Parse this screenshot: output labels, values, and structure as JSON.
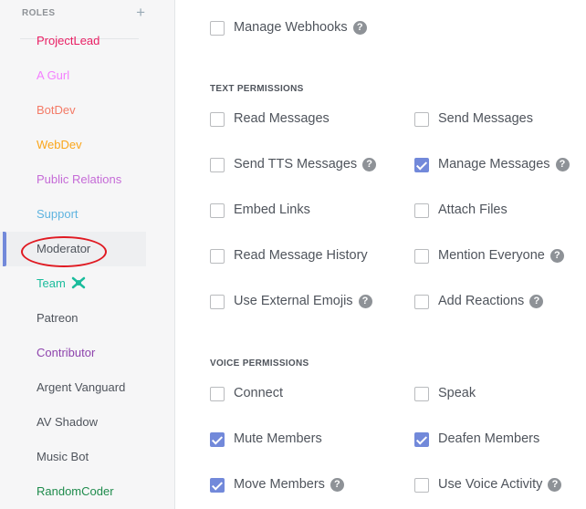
{
  "sidebar": {
    "title": "ROLES",
    "add_icon": "+",
    "roles": [
      {
        "name": "ProjectLead",
        "color": "#e91e63"
      },
      {
        "name": "A Gurl",
        "color": "#f47fff"
      },
      {
        "name": "BotDev",
        "color": "#f47b67"
      },
      {
        "name": "WebDev",
        "color": "#faa61a"
      },
      {
        "name": "Public Relations",
        "color": "#c56bd7"
      },
      {
        "name": "Support",
        "color": "#5fb4e0"
      },
      {
        "name": "Moderator",
        "color": "#4f545c",
        "selected": true,
        "highlighted": true
      },
      {
        "name": "Team",
        "color": "#1abc9c",
        "icon": "bot-badge-icon"
      },
      {
        "name": "Patreon",
        "color": "#4f545c"
      },
      {
        "name": "Contributor",
        "color": "#8e44ad"
      },
      {
        "name": "Argent Vanguard",
        "color": "#4f545c"
      },
      {
        "name": "AV Shadow",
        "color": "#4f545c"
      },
      {
        "name": "Music Bot",
        "color": "#4f545c"
      },
      {
        "name": "RandomCoder",
        "color": "#1f8b4c"
      }
    ]
  },
  "permissions": {
    "manage_webhooks": {
      "label": "Manage Webhooks",
      "checked": false,
      "help": true
    },
    "text_title": "TEXT PERMISSIONS",
    "text": [
      {
        "label": "Read Messages",
        "checked": false,
        "help": false
      },
      {
        "label": "Send Messages",
        "checked": false,
        "help": false
      },
      {
        "label": "Send TTS Messages",
        "checked": false,
        "help": true
      },
      {
        "label": "Manage Messages",
        "checked": true,
        "help": true
      },
      {
        "label": "Embed Links",
        "checked": false,
        "help": false
      },
      {
        "label": "Attach Files",
        "checked": false,
        "help": false
      },
      {
        "label": "Read Message History",
        "checked": false,
        "help": false
      },
      {
        "label": "Mention Everyone",
        "checked": false,
        "help": true
      },
      {
        "label": "Use External Emojis",
        "checked": false,
        "help": true
      },
      {
        "label": "Add Reactions",
        "checked": false,
        "help": true
      }
    ],
    "voice_title": "VOICE PERMISSIONS",
    "voice": [
      {
        "label": "Connect",
        "checked": false,
        "help": false
      },
      {
        "label": "Speak",
        "checked": false,
        "help": false
      },
      {
        "label": "Mute Members",
        "checked": true,
        "help": false
      },
      {
        "label": "Deafen Members",
        "checked": true,
        "help": false
      },
      {
        "label": "Move Members",
        "checked": true,
        "help": true
      },
      {
        "label": "Use Voice Activity",
        "checked": false,
        "help": true
      }
    ]
  },
  "help_icon": "?",
  "colors": {
    "accent": "#7289da",
    "highlight_circle": "#e01a22"
  }
}
